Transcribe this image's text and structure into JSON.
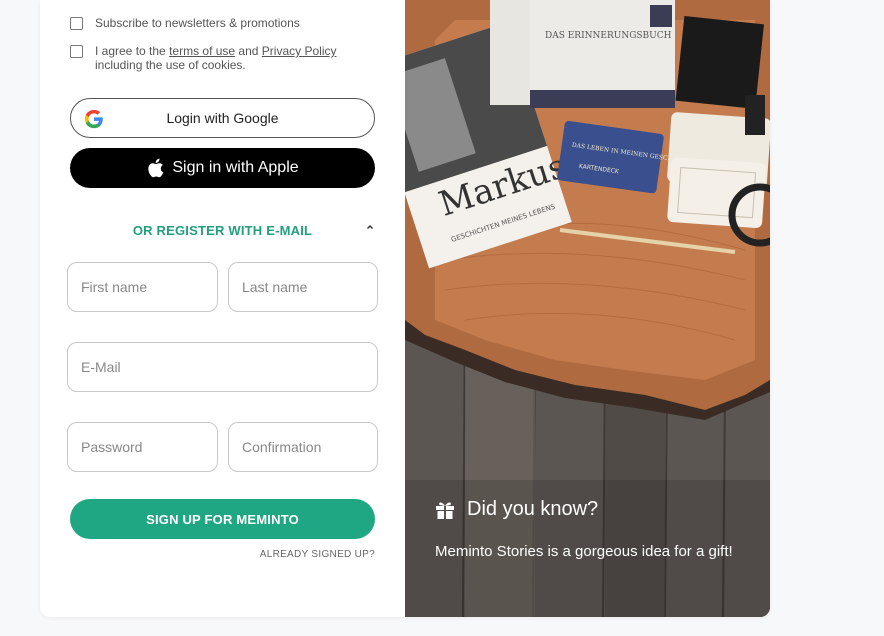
{
  "consents": {
    "newsletter": "Subscribe to newsletters & promotions",
    "terms_prefix": "I agree to the ",
    "terms_link": "terms of use",
    "terms_mid": " and ",
    "privacy_link": "Privacy Policy",
    "terms_suffix": "including the use of cookies."
  },
  "social": {
    "google_label": "Login with Google",
    "apple_label": "Sign in with Apple"
  },
  "register": {
    "toggle_label": "OR REGISTER WITH E-MAIL",
    "first_name_placeholder": "First name",
    "last_name_placeholder": "Last name",
    "email_placeholder": "E-Mail",
    "password_placeholder": "Password",
    "confirmation_placeholder": "Confirmation",
    "submit_label": "SIGN UP FOR MEMINTO",
    "already_label": "ALREADY SIGNED UP?"
  },
  "promo": {
    "heading": "Did you know?",
    "text": "Meminto Stories is a gorgeous idea for a gift!",
    "book_title": "DAS ERINNERUNGSBUCH",
    "cards_title": "DAS LEBEN IN MEINEN GESCHICHTEN",
    "cards_sub": "KARTENDECK",
    "card_name": "Markus",
    "card_sub": "GESCHICHTEN MEINES LEBENS"
  },
  "colors": {
    "accent": "#1fa783",
    "accent_text": "#22a07e",
    "apple_bg": "#000000"
  }
}
